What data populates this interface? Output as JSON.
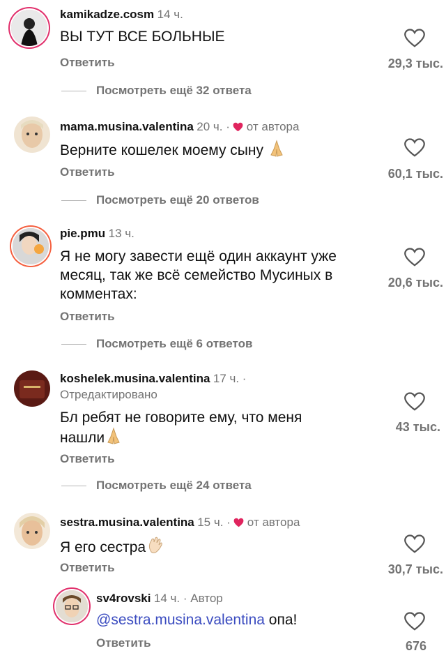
{
  "comments": [
    {
      "username": "kamikadze.cosm",
      "time": "14 ч.",
      "text": "ВЫ ТУТ ВСЕ БОЛЬНЫЕ",
      "reply": "Ответить",
      "likes": "29,3 тыс.",
      "more": "Посмотреть ещё 32 ответа",
      "avatar": "dark-figure-avatar"
    },
    {
      "username": "mama.musina.valentina",
      "time": "20 ч. ·",
      "author_badge": "от автора",
      "text": "Верните кошелек моему сыну",
      "emoji": "praying-hands",
      "reply": "Ответить",
      "likes": "60,1 тыс.",
      "more": "Посмотреть ещё 20 ответов",
      "avatar": "face-avatar"
    },
    {
      "username": "pie.pmu",
      "time": "13 ч.",
      "text_lines": [
        "Я не могу завести ещё один аккаунт уже",
        "месяц, так же всё семейство Мусиных в",
        "комментах:"
      ],
      "reply": "Ответить",
      "likes": "20,6 тыс.",
      "more": "Посмотреть ещё 6 ответов",
      "avatar": "person-avatar"
    },
    {
      "username": "koshelek.musina.valentina",
      "time": "17 ч. ·",
      "edited": "Отредактировано",
      "text_lines": [
        "Бл ребят не говорите ему, что меня",
        "нашли"
      ],
      "emoji": "praying-hands",
      "reply": "Ответить",
      "likes": "43 тыс.",
      "more": "Посмотреть ещё 24 ответа",
      "avatar": "wallet-avatar"
    },
    {
      "username": "sestra.musina.valentina",
      "time": "15 ч. ·",
      "author_badge": "от автора",
      "text": "Я его сестра",
      "emoji": "waving-hand",
      "reply": "Ответить",
      "likes": "30,7 тыс.",
      "avatar": "face-avatar"
    },
    {
      "username": "sv4rovski",
      "time": "14 ч. · Автор",
      "mention": "@sestra.musina.valentina",
      "text": "опа!",
      "reply": "Ответить",
      "likes": "676",
      "avatar": "person-glasses-avatar"
    }
  ],
  "colors": {
    "author_heart": "#e0245e",
    "mention": "#3b4cc0",
    "secondary": "#737373"
  }
}
